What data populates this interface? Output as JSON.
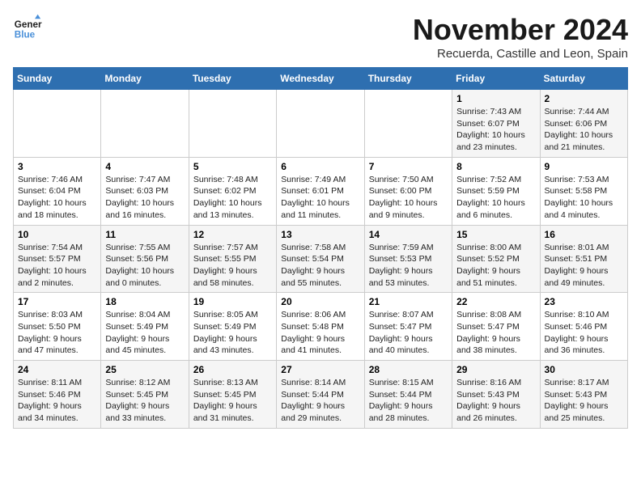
{
  "logo": {
    "line1": "General",
    "line2": "Blue"
  },
  "title": "November 2024",
  "subtitle": "Recuerda, Castille and Leon, Spain",
  "weekdays": [
    "Sunday",
    "Monday",
    "Tuesday",
    "Wednesday",
    "Thursday",
    "Friday",
    "Saturday"
  ],
  "weeks": [
    [
      {
        "day": "",
        "info": ""
      },
      {
        "day": "",
        "info": ""
      },
      {
        "day": "",
        "info": ""
      },
      {
        "day": "",
        "info": ""
      },
      {
        "day": "",
        "info": ""
      },
      {
        "day": "1",
        "info": "Sunrise: 7:43 AM\nSunset: 6:07 PM\nDaylight: 10 hours and 23 minutes."
      },
      {
        "day": "2",
        "info": "Sunrise: 7:44 AM\nSunset: 6:06 PM\nDaylight: 10 hours and 21 minutes."
      }
    ],
    [
      {
        "day": "3",
        "info": "Sunrise: 7:46 AM\nSunset: 6:04 PM\nDaylight: 10 hours and 18 minutes."
      },
      {
        "day": "4",
        "info": "Sunrise: 7:47 AM\nSunset: 6:03 PM\nDaylight: 10 hours and 16 minutes."
      },
      {
        "day": "5",
        "info": "Sunrise: 7:48 AM\nSunset: 6:02 PM\nDaylight: 10 hours and 13 minutes."
      },
      {
        "day": "6",
        "info": "Sunrise: 7:49 AM\nSunset: 6:01 PM\nDaylight: 10 hours and 11 minutes."
      },
      {
        "day": "7",
        "info": "Sunrise: 7:50 AM\nSunset: 6:00 PM\nDaylight: 10 hours and 9 minutes."
      },
      {
        "day": "8",
        "info": "Sunrise: 7:52 AM\nSunset: 5:59 PM\nDaylight: 10 hours and 6 minutes."
      },
      {
        "day": "9",
        "info": "Sunrise: 7:53 AM\nSunset: 5:58 PM\nDaylight: 10 hours and 4 minutes."
      }
    ],
    [
      {
        "day": "10",
        "info": "Sunrise: 7:54 AM\nSunset: 5:57 PM\nDaylight: 10 hours and 2 minutes."
      },
      {
        "day": "11",
        "info": "Sunrise: 7:55 AM\nSunset: 5:56 PM\nDaylight: 10 hours and 0 minutes."
      },
      {
        "day": "12",
        "info": "Sunrise: 7:57 AM\nSunset: 5:55 PM\nDaylight: 9 hours and 58 minutes."
      },
      {
        "day": "13",
        "info": "Sunrise: 7:58 AM\nSunset: 5:54 PM\nDaylight: 9 hours and 55 minutes."
      },
      {
        "day": "14",
        "info": "Sunrise: 7:59 AM\nSunset: 5:53 PM\nDaylight: 9 hours and 53 minutes."
      },
      {
        "day": "15",
        "info": "Sunrise: 8:00 AM\nSunset: 5:52 PM\nDaylight: 9 hours and 51 minutes."
      },
      {
        "day": "16",
        "info": "Sunrise: 8:01 AM\nSunset: 5:51 PM\nDaylight: 9 hours and 49 minutes."
      }
    ],
    [
      {
        "day": "17",
        "info": "Sunrise: 8:03 AM\nSunset: 5:50 PM\nDaylight: 9 hours and 47 minutes."
      },
      {
        "day": "18",
        "info": "Sunrise: 8:04 AM\nSunset: 5:49 PM\nDaylight: 9 hours and 45 minutes."
      },
      {
        "day": "19",
        "info": "Sunrise: 8:05 AM\nSunset: 5:49 PM\nDaylight: 9 hours and 43 minutes."
      },
      {
        "day": "20",
        "info": "Sunrise: 8:06 AM\nSunset: 5:48 PM\nDaylight: 9 hours and 41 minutes."
      },
      {
        "day": "21",
        "info": "Sunrise: 8:07 AM\nSunset: 5:47 PM\nDaylight: 9 hours and 40 minutes."
      },
      {
        "day": "22",
        "info": "Sunrise: 8:08 AM\nSunset: 5:47 PM\nDaylight: 9 hours and 38 minutes."
      },
      {
        "day": "23",
        "info": "Sunrise: 8:10 AM\nSunset: 5:46 PM\nDaylight: 9 hours and 36 minutes."
      }
    ],
    [
      {
        "day": "24",
        "info": "Sunrise: 8:11 AM\nSunset: 5:46 PM\nDaylight: 9 hours and 34 minutes."
      },
      {
        "day": "25",
        "info": "Sunrise: 8:12 AM\nSunset: 5:45 PM\nDaylight: 9 hours and 33 minutes."
      },
      {
        "day": "26",
        "info": "Sunrise: 8:13 AM\nSunset: 5:45 PM\nDaylight: 9 hours and 31 minutes."
      },
      {
        "day": "27",
        "info": "Sunrise: 8:14 AM\nSunset: 5:44 PM\nDaylight: 9 hours and 29 minutes."
      },
      {
        "day": "28",
        "info": "Sunrise: 8:15 AM\nSunset: 5:44 PM\nDaylight: 9 hours and 28 minutes."
      },
      {
        "day": "29",
        "info": "Sunrise: 8:16 AM\nSunset: 5:43 PM\nDaylight: 9 hours and 26 minutes."
      },
      {
        "day": "30",
        "info": "Sunrise: 8:17 AM\nSunset: 5:43 PM\nDaylight: 9 hours and 25 minutes."
      }
    ]
  ]
}
